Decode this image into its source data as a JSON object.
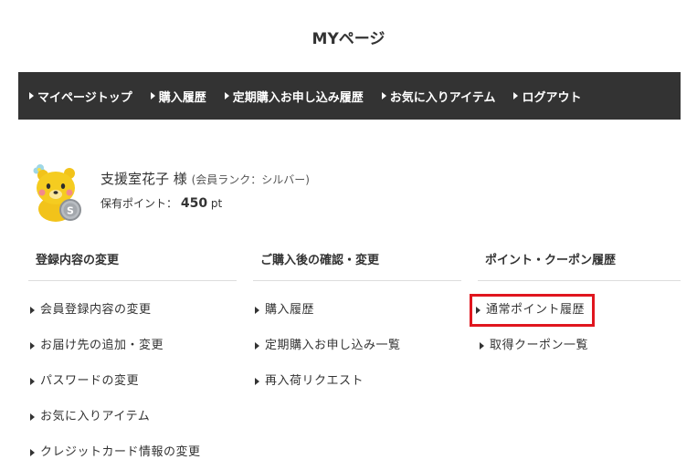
{
  "page": {
    "title": "MYページ"
  },
  "nav": {
    "items": [
      {
        "label": "マイページトップ"
      },
      {
        "label": "購入履歴"
      },
      {
        "label": "定期購入お申し込み履歴"
      },
      {
        "label": "お気に入りアイテム"
      },
      {
        "label": "ログアウト"
      }
    ]
  },
  "profile": {
    "name": "支援室花子 様",
    "rank": "(会員ランク：シルバー)",
    "points_label": "保有ポイント：",
    "points_value": "450",
    "points_unit": "pt",
    "avatar_icon": "bear-mascot-icon",
    "badge_letter": "S"
  },
  "sections": [
    {
      "title": "登録内容の変更",
      "links": [
        "会員登録内容の変更",
        "お届け先の追加・変更",
        "パスワードの変更",
        "お気に入りアイテム",
        "クレジットカード情報の変更"
      ]
    },
    {
      "title": "ご購入後の確認・変更",
      "links": [
        "購入履歴",
        "定期購入お申し込み一覧",
        "再入荷リクエスト"
      ]
    },
    {
      "title": "ポイント・クーポン履歴",
      "links": [
        "通常ポイント履歴",
        "取得クーポン一覧"
      ]
    }
  ],
  "colors": {
    "navbar": "#333333",
    "highlight": "#e0161e"
  }
}
